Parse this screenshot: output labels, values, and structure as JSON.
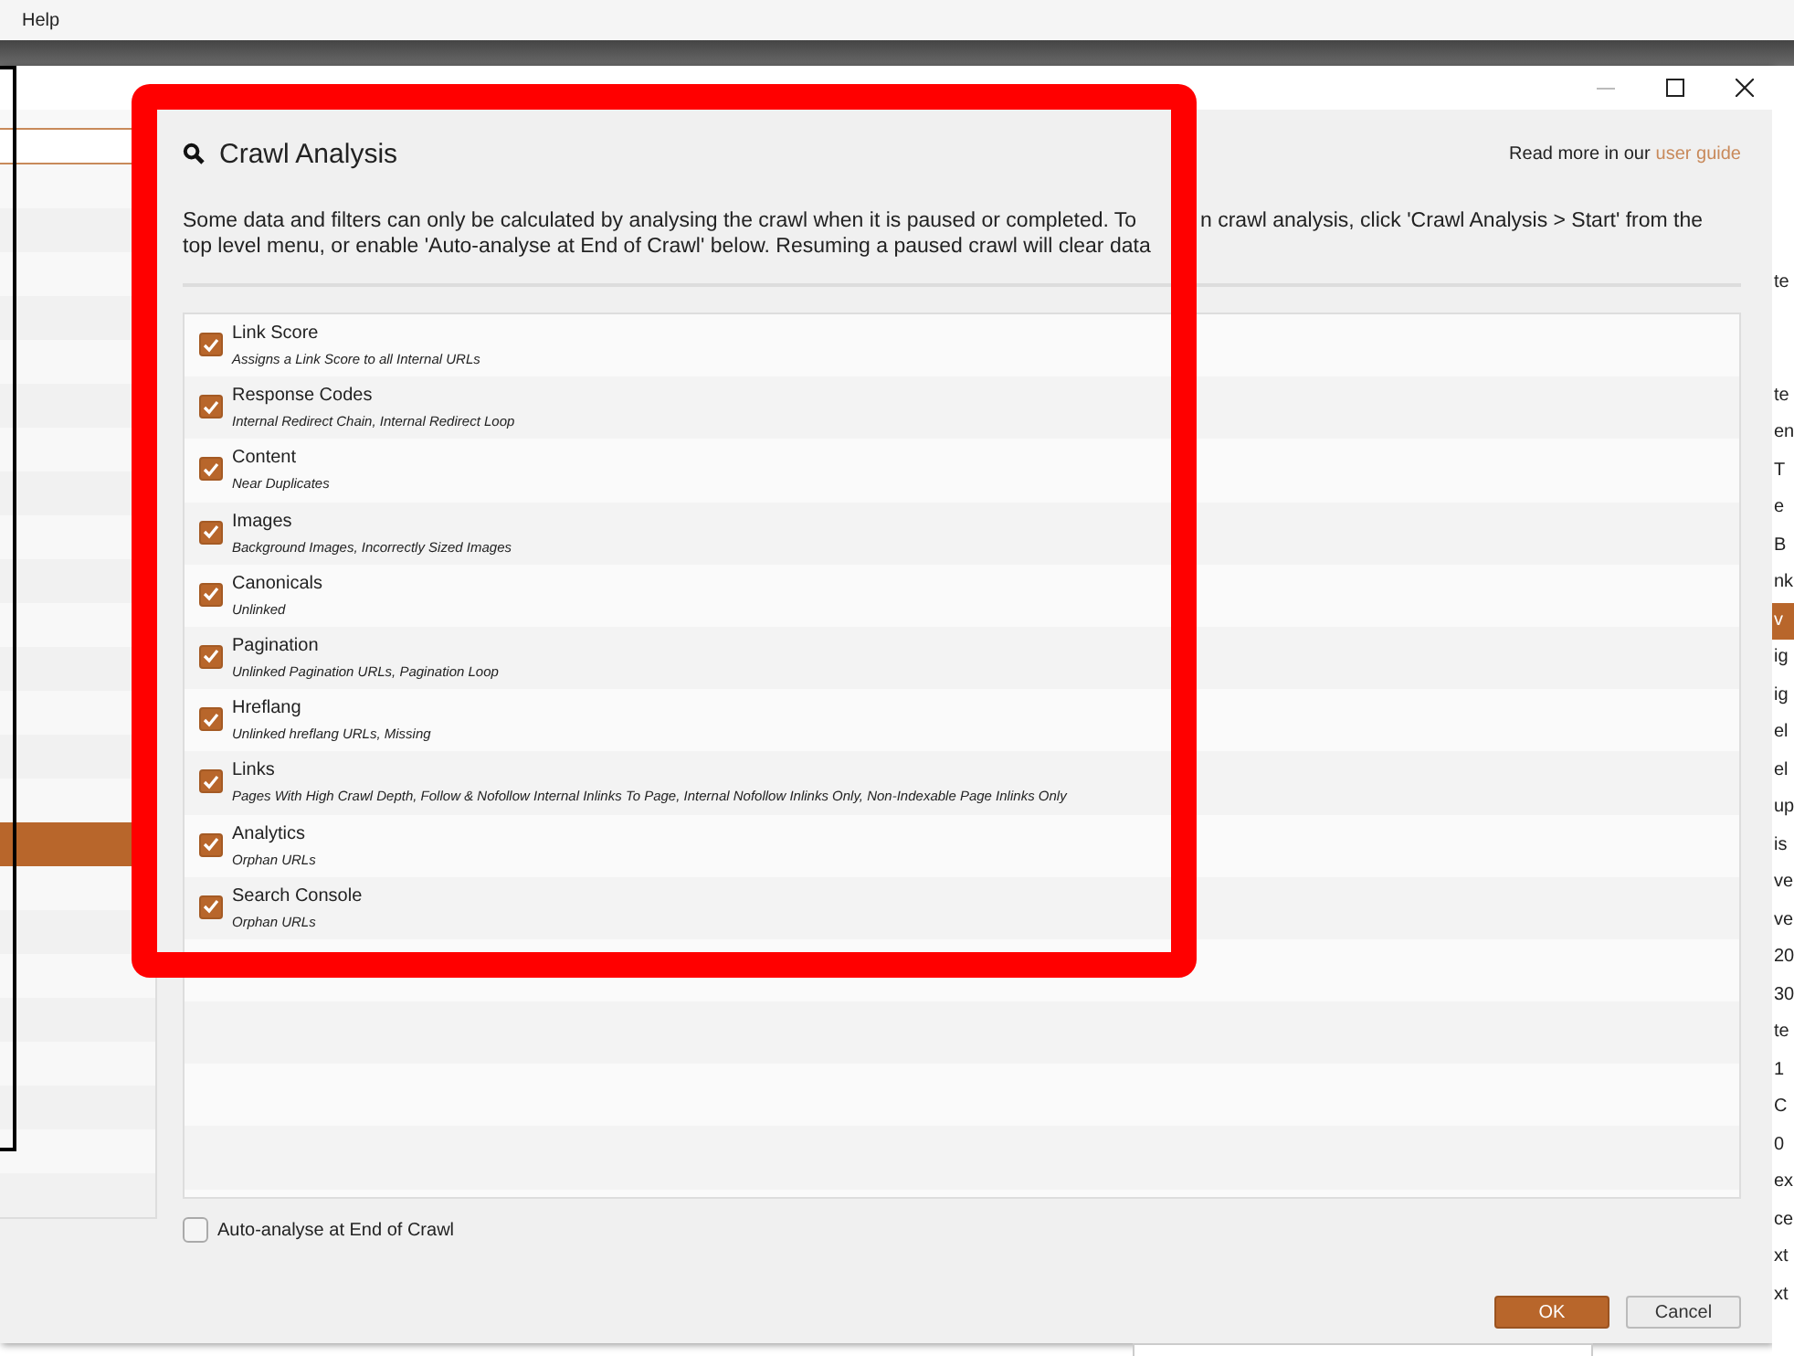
{
  "menu": [
    "Help"
  ],
  "dialog": {
    "nav_items": [
      {
        "selected": false
      },
      {
        "selected": false
      },
      {
        "selected": false
      },
      {
        "selected": false
      },
      {
        "selected": false
      },
      {
        "selected": false
      },
      {
        "selected": false
      },
      {
        "selected": false
      },
      {
        "selected": false
      },
      {
        "selected": false
      },
      {
        "selected": false
      },
      {
        "selected": false
      },
      {
        "selected": false
      },
      {
        "selected": false
      },
      {
        "selected": false
      },
      {
        "selected": true
      },
      {
        "selected": false
      },
      {
        "selected": false
      },
      {
        "selected": false
      },
      {
        "selected": false
      },
      {
        "selected": false
      },
      {
        "selected": false
      },
      {
        "selected": false
      },
      {
        "selected": false
      }
    ],
    "title": "Crawl Analysis",
    "help_text": "Read more in our",
    "help_link": "user guide",
    "description_lines": [
      {
        "left": "Some data and filters can only be calculated by analysing the crawl when it is paused or completed. To",
        "right": "n crawl analysis, click 'Crawl Analysis > Start' from the"
      },
      {
        "left": "top level menu, or enable 'Auto-analyse at End of Crawl' below. Resuming a paused crawl will clear data"
      }
    ],
    "analyses": [
      {
        "name": "Link Score",
        "detail": "Assigns a Link Score to all Internal URLs",
        "checked": true
      },
      {
        "name": "Response Codes",
        "detail": "Internal Redirect Chain, Internal Redirect Loop",
        "checked": true
      },
      {
        "name": "Content",
        "detail": "Near Duplicates",
        "checked": true
      },
      {
        "name": "Images",
        "detail": "Background Images, Incorrectly Sized Images",
        "checked": true
      },
      {
        "name": "Canonicals",
        "detail": "Unlinked",
        "checked": true
      },
      {
        "name": "Pagination",
        "detail": "Unlinked Pagination URLs, Pagination Loop",
        "checked": true
      },
      {
        "name": "Hreflang",
        "detail": "Unlinked hreflang URLs, Missing",
        "checked": true
      },
      {
        "name": "Links",
        "detail": "Pages With High Crawl Depth, Follow & Nofollow Internal Inlinks To Page, Internal Nofollow Inlinks Only, Non-Indexable Page Inlinks Only",
        "checked": true
      },
      {
        "name": "Analytics",
        "detail": "Orphan URLs",
        "checked": true
      },
      {
        "name": "Search Console",
        "detail": "Orphan URLs",
        "checked": true
      }
    ],
    "auto_analyse": {
      "label": "Auto-analyse at End of Crawl",
      "checked": false
    },
    "buttons": [
      "OK",
      "Cancel"
    ]
  },
  "background_header": "te",
  "background_rows": [
    {
      "text": "te",
      "selected": false
    },
    {
      "text": "en",
      "selected": false
    },
    {
      "text": "T",
      "selected": false
    },
    {
      "text": "e",
      "selected": false
    },
    {
      "text": "B",
      "selected": false
    },
    {
      "text": "nk",
      "selected": false
    },
    {
      "text": "v",
      "selected": true
    },
    {
      "text": "ig",
      "selected": false
    },
    {
      "text": "ig",
      "selected": false
    },
    {
      "text": "el",
      "selected": false
    },
    {
      "text": "el",
      "selected": false
    },
    {
      "text": "up",
      "selected": false
    },
    {
      "text": "is",
      "selected": false
    },
    {
      "text": "ve",
      "selected": false
    },
    {
      "text": "ve",
      "selected": false
    },
    {
      "text": "20",
      "selected": false
    },
    {
      "text": "30",
      "selected": false
    },
    {
      "text": "te",
      "selected": false
    },
    {
      "text": "1",
      "selected": false
    },
    {
      "text": "C",
      "selected": false
    },
    {
      "text": "0",
      "selected": false
    },
    {
      "text": "ex",
      "selected": false
    },
    {
      "text": "ce",
      "selected": false
    },
    {
      "text": "xt",
      "selected": false
    },
    {
      "text": "xt",
      "selected": false
    }
  ]
}
